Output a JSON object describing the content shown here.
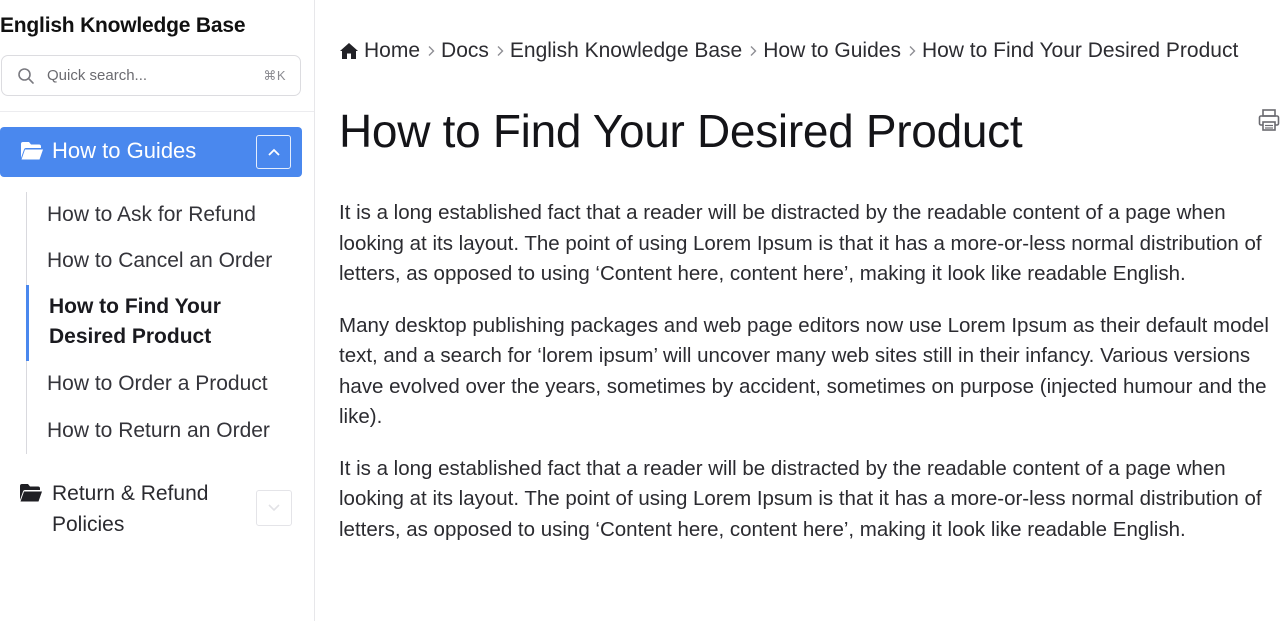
{
  "sidebar": {
    "title": "English Knowledge Base",
    "search": {
      "placeholder": "Quick search...",
      "shortcut": "⌘K",
      "icon": "search-icon"
    },
    "active_category": {
      "label": "How to Guides",
      "icon": "folder-open-icon",
      "toggle_icon": "chevron-up-icon",
      "background": "#4a88ee"
    },
    "items": [
      {
        "label": "How to Ask for Refund",
        "active": false
      },
      {
        "label": "How to Cancel an Order",
        "active": false
      },
      {
        "label": "How to Find Your Desired Product",
        "active": true
      },
      {
        "label": "How to Order a Product",
        "active": false
      },
      {
        "label": "How to Return an Order",
        "active": false
      }
    ],
    "other_category": {
      "label": "Return & Refund Policies",
      "icon": "folder-open-icon",
      "toggle_icon": "chevron-down-icon"
    }
  },
  "breadcrumb": {
    "home_icon": "home-icon",
    "items": [
      "Home",
      "Docs",
      "English Knowledge Base",
      "How to Guides",
      "How to Find Your Desired Product"
    ]
  },
  "main": {
    "title": "How to Find Your Desired Product",
    "print_icon": "printer-icon",
    "paragraphs": [
      "It is a long established fact that a reader will be distracted by the readable content of a page when looking at its layout. The point of using Lorem Ipsum is that it has a more-or-less normal distribution of letters, as opposed to using ‘Content here, content here’, making it look like readable English.",
      "Many desktop publishing packages and web page editors now use Lorem Ipsum as their default model text, and a search for ‘lorem ipsum’ will uncover many web sites still in their infancy. Various versions have evolved over the years, sometimes by accident, sometimes on purpose (injected humour and the like).",
      "It is a long established fact that a reader will be distracted by the readable content of a page when looking at its layout. The point of using Lorem Ipsum is that it has a more-or-less normal distribution of letters, as opposed to using ‘Content here, content here’, making it look like readable English."
    ]
  },
  "colors": {
    "accent": "#4a88ee",
    "text": "#2b2b30",
    "border": "#dcdce0"
  }
}
